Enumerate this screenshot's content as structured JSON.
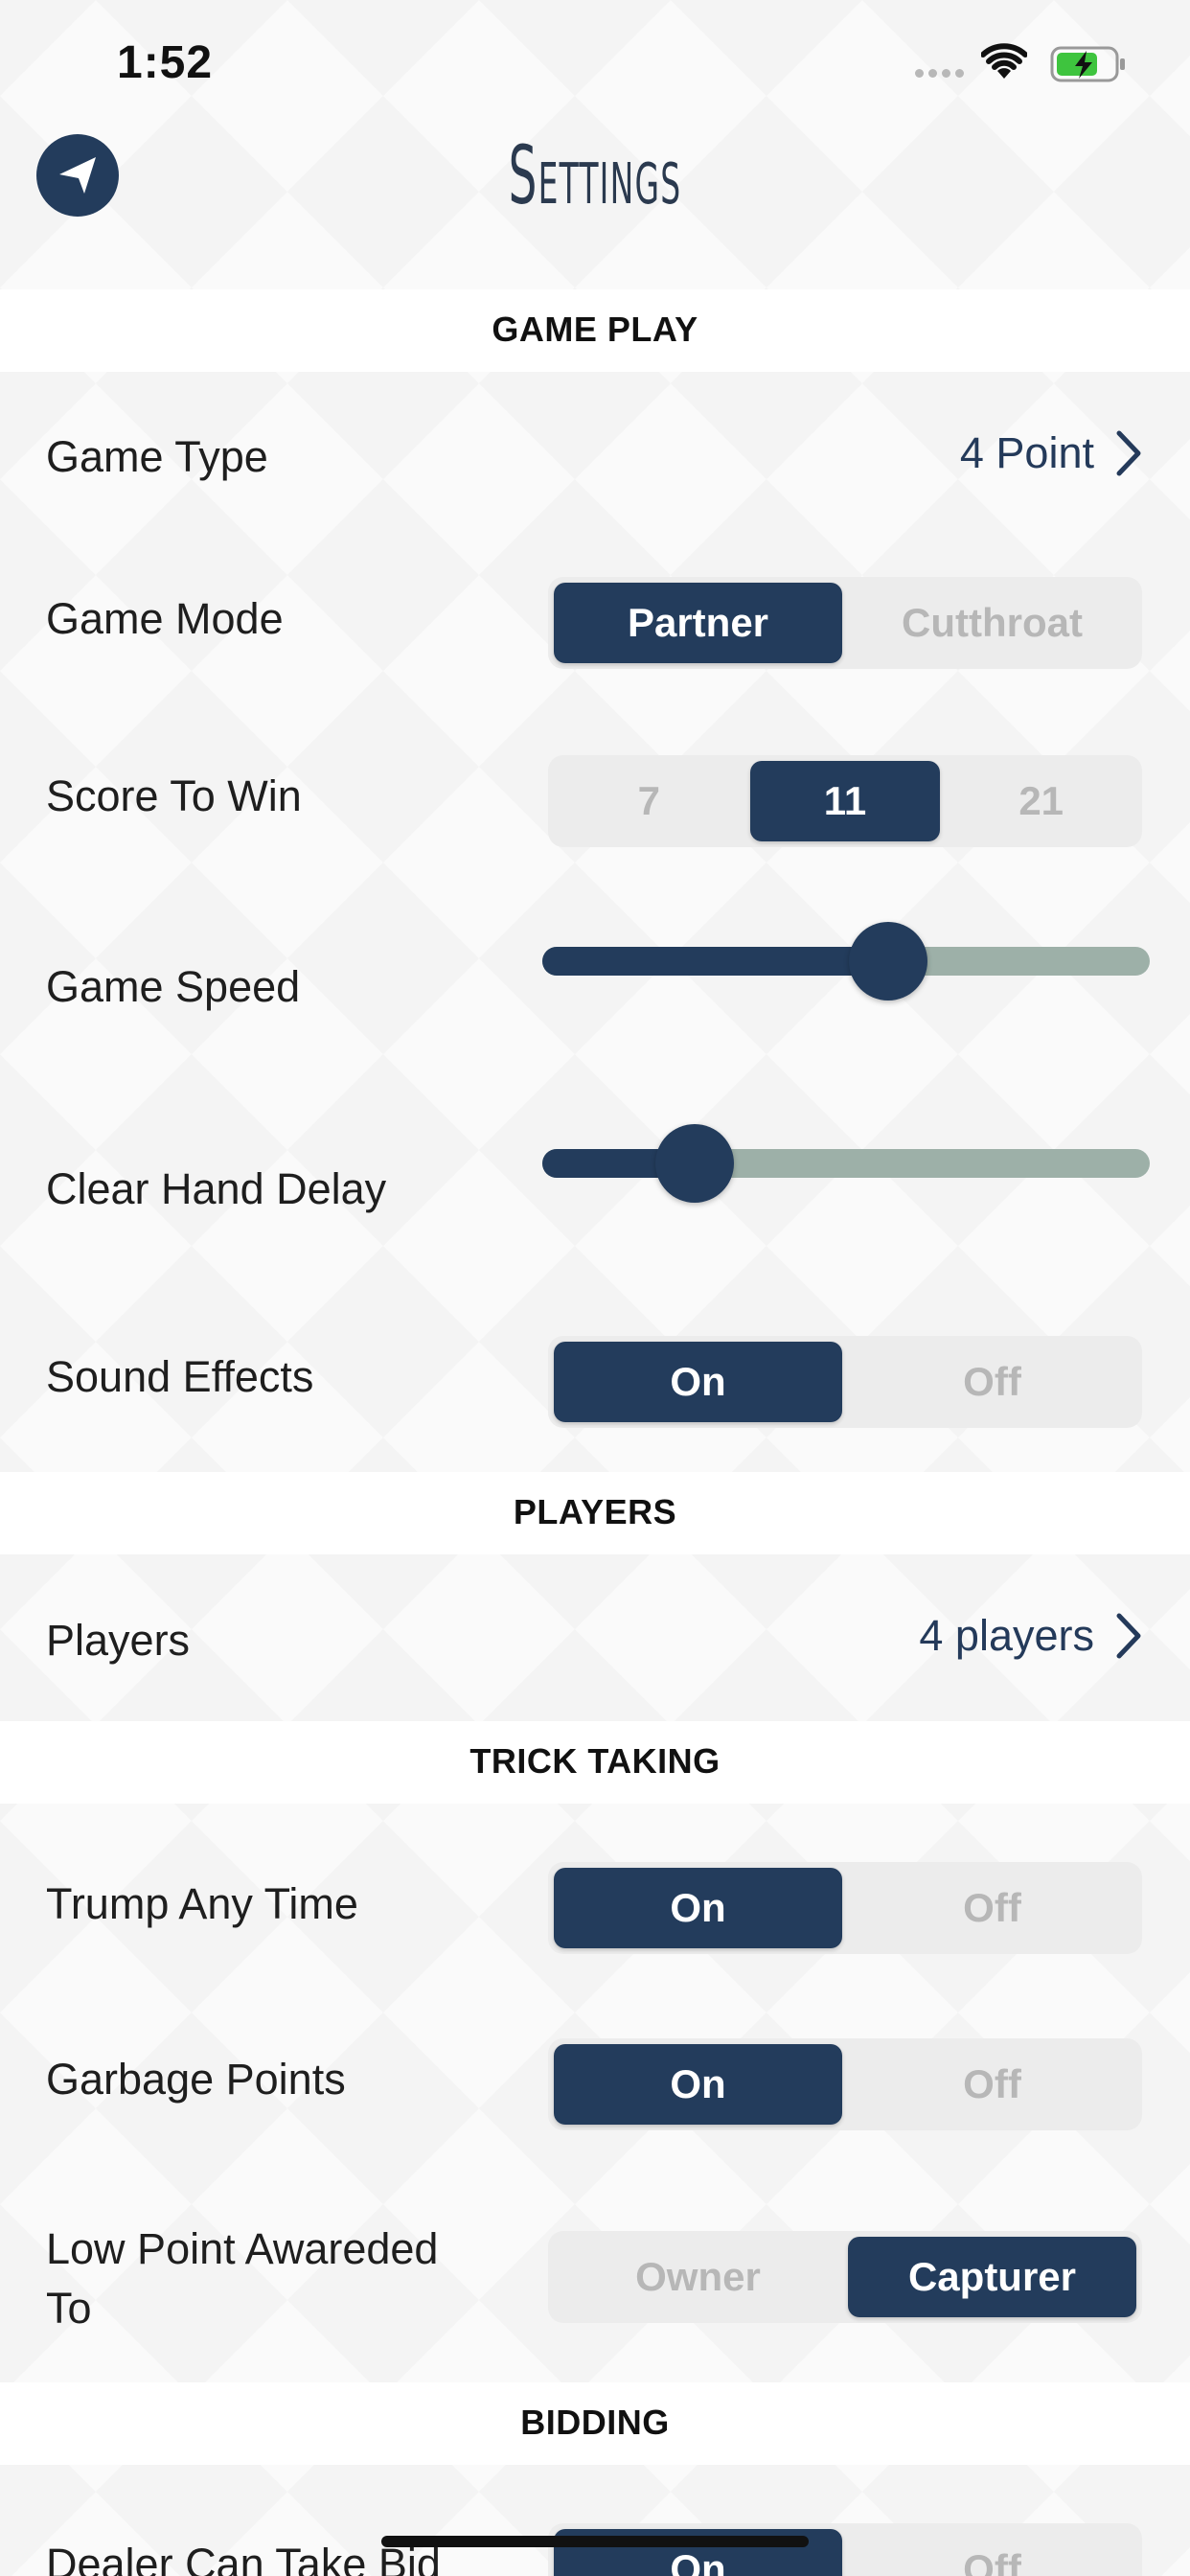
{
  "status": {
    "time": "1:52"
  },
  "header": {
    "title": "Settings"
  },
  "sections": {
    "game_play": "GAME PLAY",
    "players": "PLAYERS",
    "trick_taking": "TRICK TAKING",
    "bidding": "BIDDING"
  },
  "game_type": {
    "label": "Game Type",
    "value": "4 Point"
  },
  "game_mode": {
    "label": "Game Mode",
    "options": [
      "Partner",
      "Cutthroat"
    ],
    "selected": 0
  },
  "score_to_win": {
    "label": "Score To Win",
    "options": [
      "7",
      "11",
      "21"
    ],
    "selected": 1
  },
  "game_speed": {
    "label": "Game Speed",
    "level": 0.57
  },
  "clear_hand_delay": {
    "label": "Clear Hand Delay",
    "level": 0.25
  },
  "sound_effects": {
    "label": "Sound Effects",
    "options": [
      "On",
      "Off"
    ],
    "selected": 0
  },
  "players": {
    "label": "Players",
    "value": "4 players"
  },
  "trump_any_time": {
    "label": "Trump Any Time",
    "options": [
      "On",
      "Off"
    ],
    "selected": 0
  },
  "garbage_points": {
    "label": "Garbage Points",
    "options": [
      "On",
      "Off"
    ],
    "selected": 0
  },
  "low_point": {
    "label_line1": "Low Point Awareded",
    "label_line2": "To",
    "options": [
      "Owner",
      "Capturer"
    ],
    "selected": 1
  },
  "dealer_take_bid": {
    "label": "Dealer Can Take Bid",
    "options": [
      "On",
      "Off"
    ],
    "selected": 0
  },
  "colors": {
    "accent": "#233c5c",
    "slider_track": "#9db0a8",
    "segment_bg": "#ececec"
  },
  "icons": {
    "back": "back-arrow-icon",
    "chevron": "chevron-right-icon",
    "wifi": "wifi-icon",
    "battery": "battery-charging-icon"
  }
}
